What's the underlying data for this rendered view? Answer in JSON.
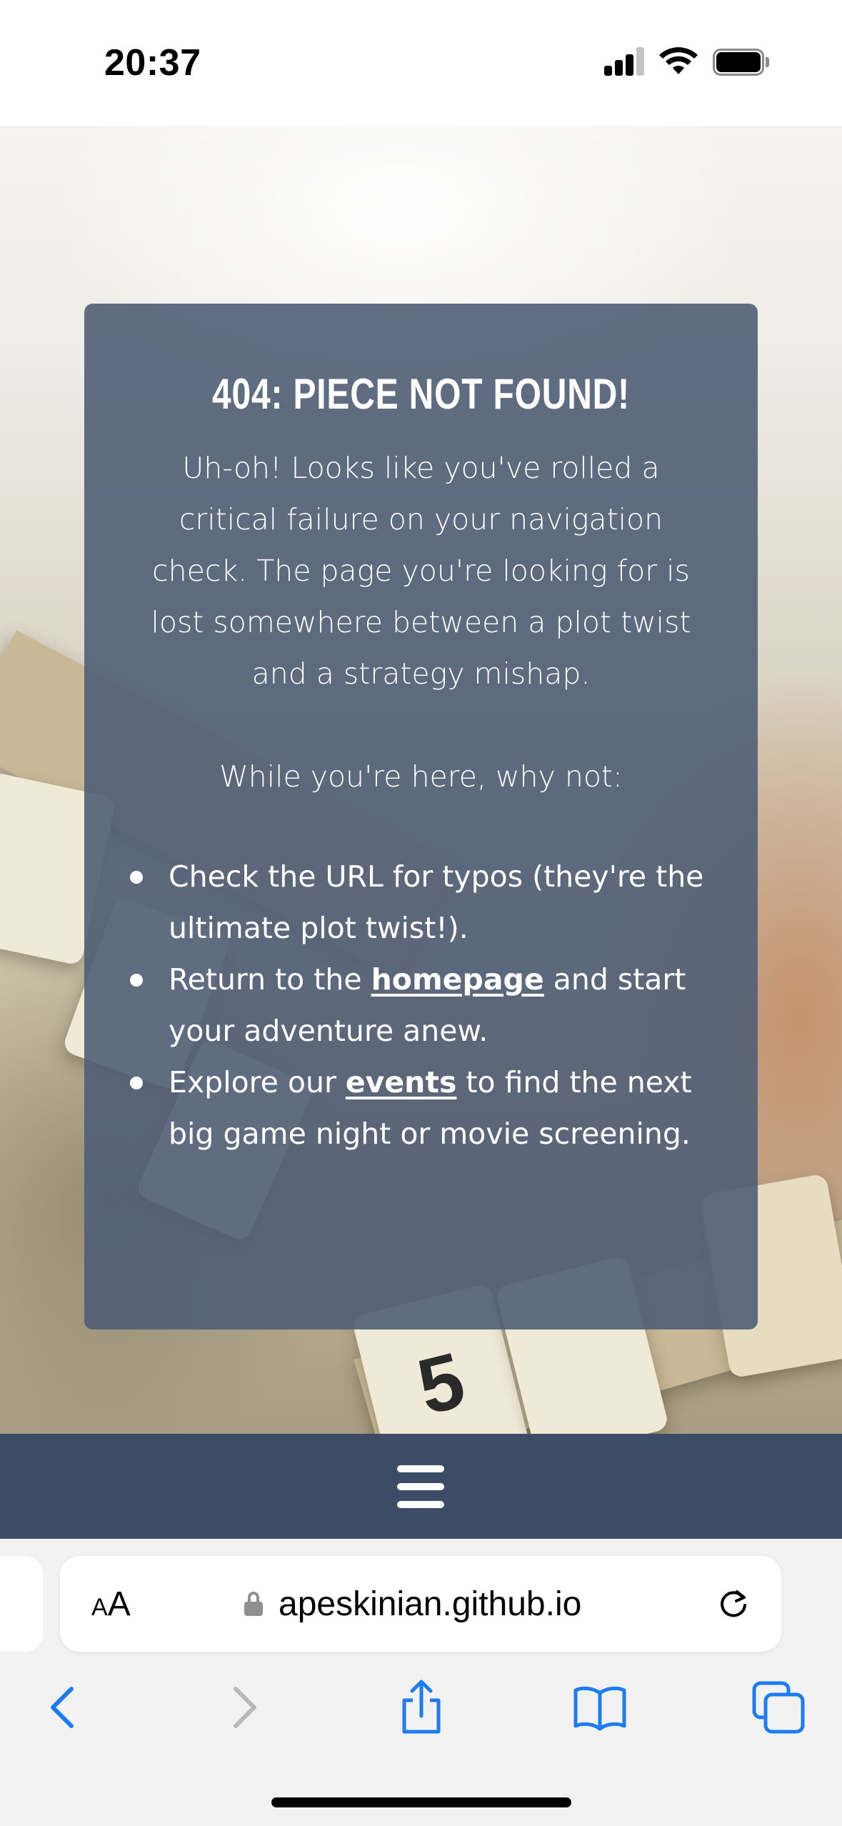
{
  "status_bar": {
    "time": "20:37",
    "icons": [
      "cellular-signal-icon",
      "wifi-icon",
      "battery-icon"
    ]
  },
  "card": {
    "title": "404: PIECE NOT FOUND!",
    "intro": "Uh-oh! Looks like you've rolled a critical failure on your navigation check. The page you're looking for is lost somewhere between a plot twist and a strategy mishap.",
    "prompt": "While you're here, why not:",
    "items": [
      {
        "text": "Check the URL for typos (they're the ultimate plot twist!)."
      },
      {
        "before": "Return to the ",
        "link": "homepage",
        "after": " and start your adventure anew."
      },
      {
        "before": "Explore our ",
        "link": "events",
        "after": " to find the next big game night or movie screening."
      }
    ]
  },
  "navbar": {
    "menu_icon": "hamburger-menu-icon"
  },
  "browser": {
    "text_size_label_small": "A",
    "text_size_label_big": "A",
    "url": "apeskinian.github.io",
    "toolbar": [
      "back-icon",
      "forward-icon",
      "share-icon",
      "bookmarks-icon",
      "tabs-icon"
    ]
  },
  "colors": {
    "card_bg": "#505e76",
    "navbar_bg": "#3c4c66",
    "browser_blue": "#1e7cf2"
  }
}
